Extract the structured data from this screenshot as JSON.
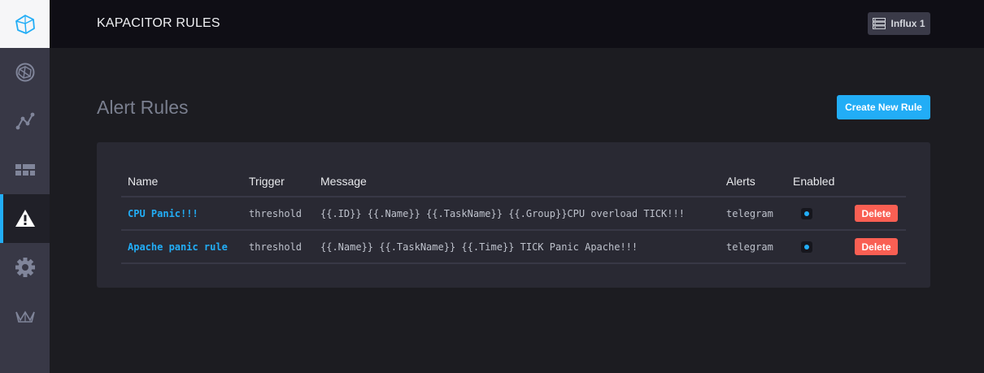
{
  "sidebar": {
    "items": [
      {
        "name": "logo",
        "icon": "influx-logo-icon"
      },
      {
        "name": "host-list",
        "icon": "cubo-icon"
      },
      {
        "name": "data-explorer",
        "icon": "graph-icon"
      },
      {
        "name": "dashboards",
        "icon": "dashboards-icon"
      },
      {
        "name": "alerting",
        "icon": "alert-triangle-icon"
      },
      {
        "name": "configuration",
        "icon": "gear-icon"
      },
      {
        "name": "admin",
        "icon": "crown-icon"
      }
    ]
  },
  "header": {
    "title": "KAPACITOR RULES",
    "source_label": "Influx 1"
  },
  "page": {
    "title": "Alert Rules",
    "create_label": "Create New Rule"
  },
  "table": {
    "columns": [
      "Name",
      "Trigger",
      "Message",
      "Alerts",
      "Enabled",
      ""
    ],
    "rows": [
      {
        "name": "CPU Panic!!!",
        "trigger": "threshold",
        "message": "{{.ID}} {{.Name}} {{.TaskName}} {{.Group}}CPU overload TICK!!!",
        "alerts": "telegram",
        "enabled": true,
        "delete_label": "Delete"
      },
      {
        "name": "Apache panic rule",
        "trigger": "threshold",
        "message": "{{.Name}} {{.TaskName}} {{.Time}} TICK Panic Apache!!!",
        "alerts": "telegram",
        "enabled": true,
        "delete_label": "Delete"
      }
    ]
  },
  "colors": {
    "accent": "#22adf6",
    "danger": "#f95f53",
    "sidebar_bg": "#383846",
    "header_bg": "#0f0e15",
    "panel_bg": "#292933"
  }
}
